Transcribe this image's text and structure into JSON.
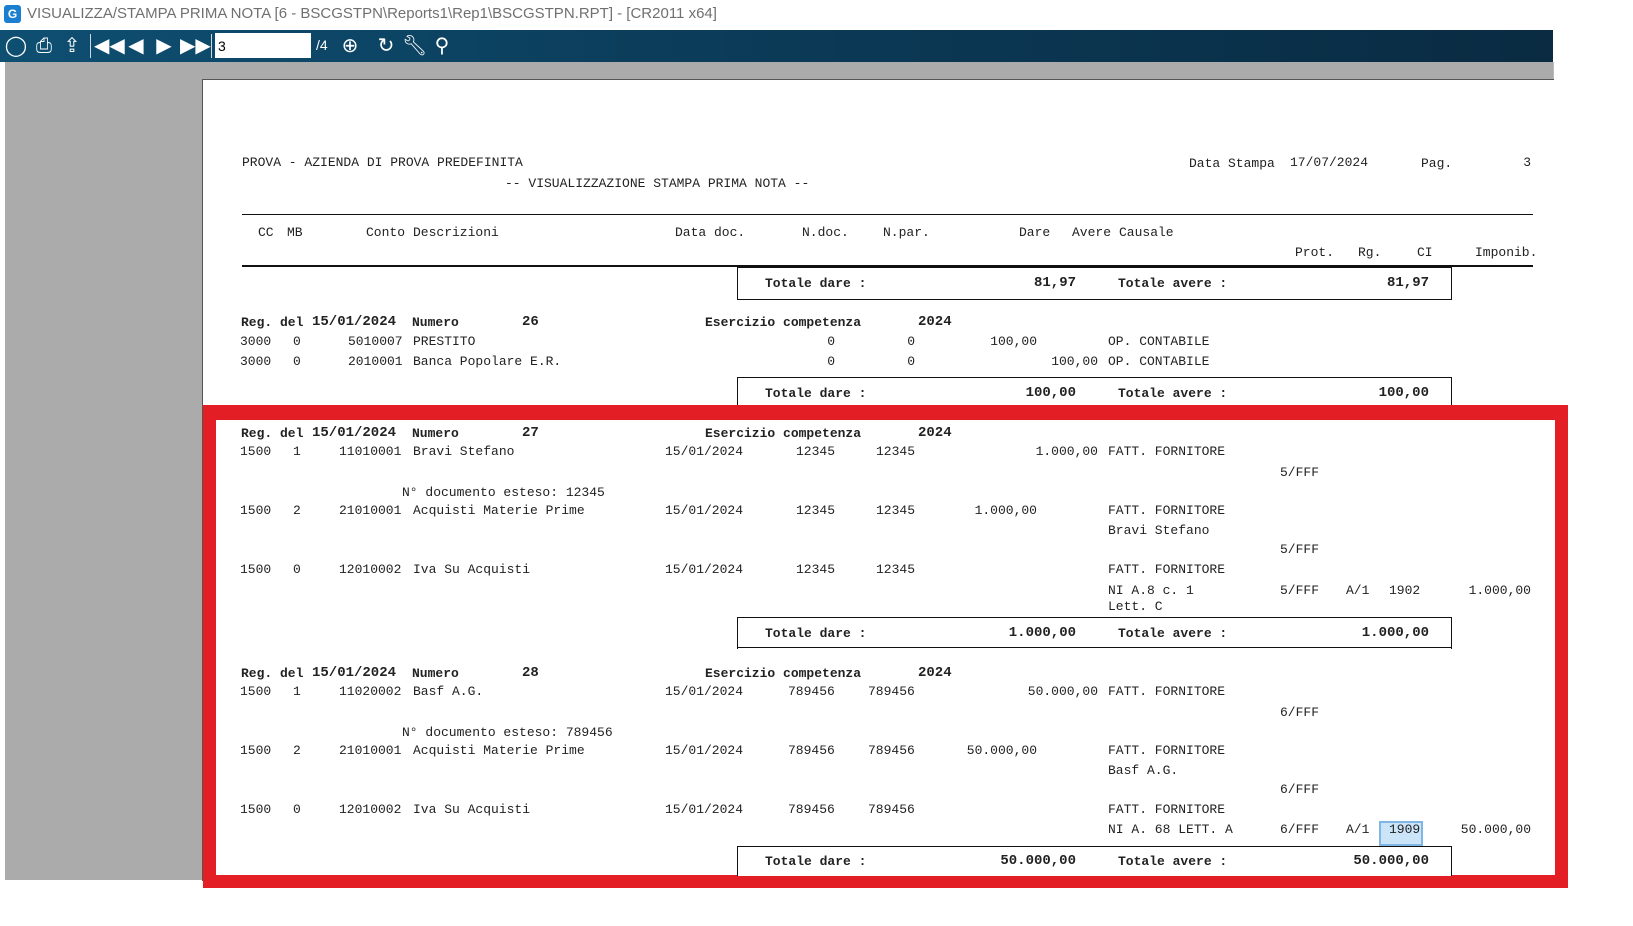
{
  "window": {
    "title": "VISUALIZZA/STAMPA PRIMA NOTA [6 - BSCGSTPN\\Reports1\\Rep1\\BSCGSTPN.RPT] - [CR2011 x64]",
    "app_icon": "G"
  },
  "toolbar": {
    "page_value": "3",
    "page_count": "/4",
    "icons": [
      "export-icon",
      "print-icon",
      "upload-icon",
      "first-page-icon",
      "prev-page-icon",
      "next-page-icon",
      "last-page-icon",
      "zoom-icon",
      "refresh-icon",
      "settings-icon",
      "search-icon"
    ]
  },
  "report": {
    "company": "PROVA - AZIENDA DI PROVA PREDEFINITA",
    "subtitle": "-- VISUALIZZAZIONE STAMPA PRIMA NOTA --",
    "date_label": "Data Stampa",
    "date": "17/07/2024",
    "page_label": "Pag.",
    "page": "3",
    "columns": {
      "cc": "CC",
      "mb": "MB",
      "conto": "Conto",
      "descrizioni": "Descrizioni",
      "data_doc": "Data doc.",
      "ndoc": "N.doc.",
      "npar": "N.par.",
      "dare": "Dare",
      "avere": "Avere",
      "causale": "Causale",
      "prot": "Prot.",
      "rg": "Rg.",
      "ci": "CI",
      "imponib": "Imponib."
    },
    "labels": {
      "tot_dare": "Totale dare :",
      "tot_avere": "Totale avere :",
      "reg_del": "Reg. del",
      "numero": "Numero",
      "esercizio": "Esercizio competenza"
    },
    "totals": [
      {
        "dare": "81,97",
        "avere": "81,97"
      },
      {
        "dare": "100,00",
        "avere": "100,00"
      },
      {
        "dare": "1.000,00",
        "avere": "1.000,00"
      },
      {
        "dare": "50.000,00",
        "avere": "50.000,00"
      }
    ],
    "entries": [
      {
        "date": "15/01/2024",
        "numero": "26",
        "esercizio": "2024",
        "lines": [
          {
            "cc": "3000",
            "mb": "0",
            "conto": "5010007",
            "desc": "PRESTITO",
            "ndoc": "0",
            "npar": "0",
            "dare": "100,00",
            "causale": "OP. CONTABILE"
          },
          {
            "cc": "3000",
            "mb": "0",
            "conto": "2010001",
            "desc": "Banca Popolare E.R.",
            "ndoc": "0",
            "npar": "0",
            "avere": "100,00",
            "causale": "OP. CONTABILE"
          }
        ]
      },
      {
        "date": "15/01/2024",
        "numero": "27",
        "esercizio": "2024",
        "lines": [
          {
            "cc": "1500",
            "mb": "1",
            "conto": "11010001",
            "desc": "Bravi Stefano",
            "data_doc": "15/01/2024",
            "ndoc": "12345",
            "npar": "12345",
            "avere": "1.000,00",
            "causale": "FATT. FORNITORE",
            "prot": "5/FFF",
            "extra": "N° documento esteso: 12345"
          },
          {
            "cc": "1500",
            "mb": "2",
            "conto": "21010001",
            "desc": "Acquisti Materie Prime",
            "data_doc": "15/01/2024",
            "ndoc": "12345",
            "npar": "12345",
            "dare": "1.000,00",
            "causale": "FATT. FORNITORE",
            "causale2": "Bravi Stefano",
            "prot": "5/FFF"
          },
          {
            "cc": "1500",
            "mb": "0",
            "conto": "12010002",
            "desc": "Iva Su Acquisti",
            "data_doc": "15/01/2024",
            "ndoc": "12345",
            "npar": "12345",
            "causale": "FATT. FORNITORE",
            "causale2": "NI A.8 c. 1",
            "causale3": "Lett. C",
            "prot": "5/FFF",
            "rg": "A/1",
            "ci": "1902",
            "imponib": "1.000,00"
          }
        ]
      },
      {
        "date": "15/01/2024",
        "numero": "28",
        "esercizio": "2024",
        "lines": [
          {
            "cc": "1500",
            "mb": "1",
            "conto": "11020002",
            "desc": "Basf A.G.",
            "data_doc": "15/01/2024",
            "ndoc": "789456",
            "npar": "789456",
            "avere": "50.000,00",
            "causale": "FATT. FORNITORE",
            "prot": "6/FFF",
            "extra": "N° documento esteso: 789456"
          },
          {
            "cc": "1500",
            "mb": "2",
            "conto": "21010001",
            "desc": "Acquisti Materie Prime",
            "data_doc": "15/01/2024",
            "ndoc": "789456",
            "npar": "789456",
            "dare": "50.000,00",
            "causale": "FATT. FORNITORE",
            "causale2": "Basf A.G.",
            "prot": "6/FFF"
          },
          {
            "cc": "1500",
            "mb": "0",
            "conto": "12010002",
            "desc": "Iva Su Acquisti",
            "data_doc": "15/01/2024",
            "ndoc": "789456",
            "npar": "789456",
            "causale": "FATT. FORNITORE",
            "causale2": "NI A. 68 LETT. A",
            "prot": "6/FFF",
            "rg": "A/1",
            "ci": "1909",
            "imponib": "50.000,00"
          }
        ]
      }
    ]
  },
  "colors": {
    "highlight": "#e31e24",
    "toolbar": "#0b3a57"
  }
}
